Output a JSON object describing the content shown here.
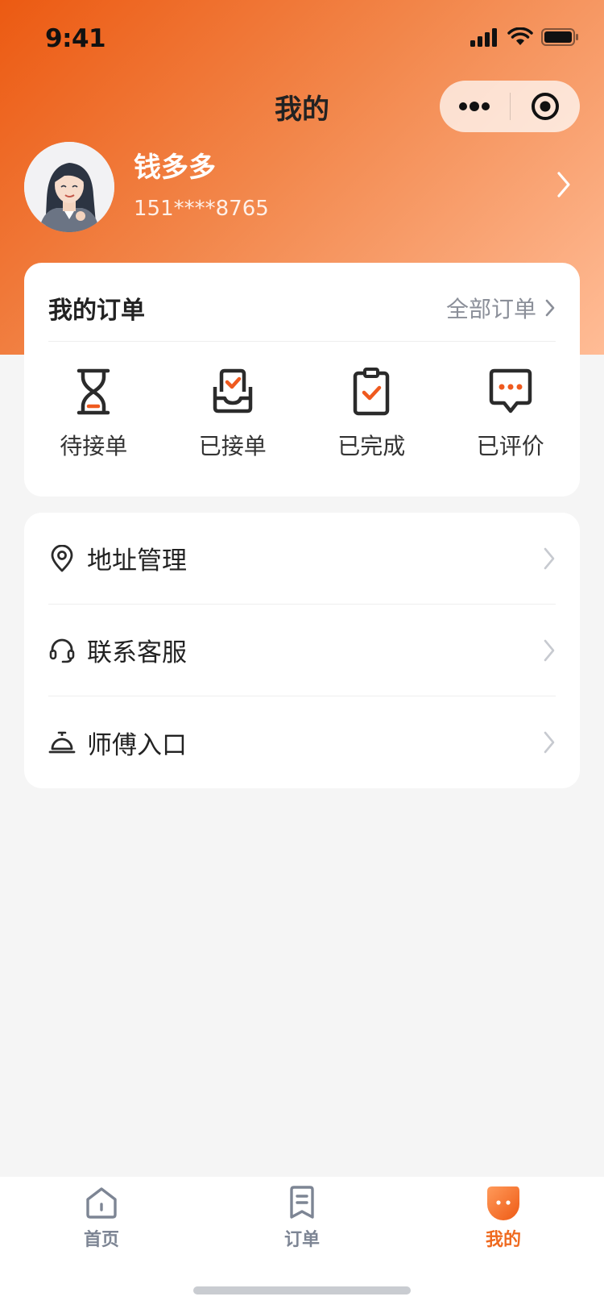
{
  "status_bar": {
    "time": "9:41"
  },
  "nav": {
    "title": "我的"
  },
  "user": {
    "name": "钱多多",
    "phone": "151****8765"
  },
  "orders": {
    "title": "我的订单",
    "all_label": "全部订单",
    "items": [
      {
        "label": "待接单",
        "icon": "hourglass-icon"
      },
      {
        "label": "已接单",
        "icon": "inbox-check-icon"
      },
      {
        "label": "已完成",
        "icon": "clipboard-check-icon"
      },
      {
        "label": "已评价",
        "icon": "chat-bubble-icon"
      }
    ]
  },
  "menu": [
    {
      "label": "地址管理",
      "icon": "location-pin-icon"
    },
    {
      "label": "联系客服",
      "icon": "headset-icon"
    },
    {
      "label": "师傅入口",
      "icon": "service-bell-icon"
    }
  ],
  "tabbar": [
    {
      "label": "首页",
      "icon": "home-icon",
      "active": false
    },
    {
      "label": "订单",
      "icon": "order-icon",
      "active": false
    },
    {
      "label": "我的",
      "icon": "mine-icon",
      "active": true
    }
  ],
  "colors": {
    "accent": "#ef6a1f",
    "gradient_start": "#ec5a12",
    "gradient_end": "#ffbc96"
  }
}
